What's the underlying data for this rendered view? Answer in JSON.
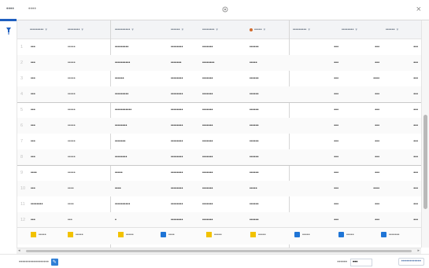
{
  "app": {
    "title": "••••",
    "sheet_name": "••••",
    "close_label": "×"
  },
  "columns": [
    {
      "label": "•••••••••"
    },
    {
      "label": "••••••••"
    },
    {
      "label": "••••••••••"
    },
    {
      "label": "••••••"
    },
    {
      "label": "••••••••"
    },
    {
      "label": "•••••"
    },
    {
      "label": "•••••••••"
    },
    {
      "label": "••••••••"
    },
    {
      "label": "••••••"
    }
  ],
  "rows": [
    {
      "num": "1",
      "name": "•••",
      "type": "•••••",
      "desc": "•••••••••",
      "d1": "••••••••",
      "d2": "•••••••",
      "code": "••••••",
      "v1": "•••",
      "v2": "•••",
      "v3": "•••"
    },
    {
      "num": "2",
      "name": "•••",
      "type": "•••••",
      "desc": "••••••••••",
      "d1": "•••••••",
      "d2": "••••••••",
      "code": "•••••",
      "v1": "•••",
      "v2": "•••",
      "v3": "•••"
    },
    {
      "num": "3",
      "name": "•••",
      "type": "•••••",
      "desc": "••••••",
      "d1": "••••••••",
      "d2": "•••••••",
      "code": "••••••",
      "v1": "•••",
      "v2": "••••",
      "v3": "•••"
    },
    {
      "num": "4",
      "name": "•••",
      "type": "•••••",
      "desc": "•••••••••",
      "d1": "••••••••",
      "d2": "•••••••",
      "code": "••••••",
      "v1": "•••",
      "v2": "•••",
      "v3": "•••"
    },
    {
      "num": "5",
      "name": "•••",
      "type": "•••••",
      "desc": "•••••••••••",
      "d1": "••••••••",
      "d2": "•••••••",
      "code": "••••••",
      "v1": "•••",
      "v2": "•••",
      "v3": "•••"
    },
    {
      "num": "6",
      "name": "•••",
      "type": "•••••",
      "desc": "••••••••",
      "d1": "••••••••",
      "d2": "•••••••",
      "code": "••••••",
      "v1": "•••",
      "v2": "•••",
      "v3": "•••"
    },
    {
      "num": "7",
      "name": "•••",
      "type": "•••••",
      "desc": "•••••••",
      "d1": "••••••••",
      "d2": "•••••••",
      "code": "••••••",
      "v1": "•••",
      "v2": "•••",
      "v3": "•••"
    },
    {
      "num": "8",
      "name": "•••",
      "type": "•••••",
      "desc": "••••••••",
      "d1": "••••••••",
      "d2": "•••••••",
      "code": "••••••",
      "v1": "•••",
      "v2": "•••",
      "v3": "•••"
    },
    {
      "num": "9",
      "name": "••••",
      "type": "•••••",
      "desc": "•••••",
      "d1": "••••••••",
      "d2": "•••••••",
      "code": "••••••",
      "v1": "•••",
      "v2": "•••",
      "v3": "•••"
    },
    {
      "num": "10",
      "name": "•••",
      "type": "••••",
      "desc": "••••",
      "d1": "••••••••",
      "d2": "•••••••",
      "code": "•••••",
      "v1": "•••",
      "v2": "••••",
      "v3": "•••"
    },
    {
      "num": "11",
      "name": "••••••••",
      "type": "••••",
      "desc": "••••••••••",
      "d1": "••••••••",
      "d2": "•••••••",
      "code": "••••••",
      "v1": "•••",
      "v2": "•••",
      "v3": "•••"
    },
    {
      "num": "12",
      "name": "•••",
      "type": "•••",
      "desc": "•",
      "d1": "••••••••",
      "d2": "•••••••",
      "code": "••••••",
      "v1": "•••",
      "v2": "•••",
      "v3": "•••"
    }
  ],
  "legend": [
    {
      "label": "•••••",
      "color": "#f2c200"
    },
    {
      "label": "•••••",
      "color": "#f2c200"
    },
    {
      "label": "•••••",
      "color": "#f2c200"
    },
    {
      "label": "••••",
      "color": "#1f75d6"
    },
    {
      "label": "•••••",
      "color": "#f2c200"
    },
    {
      "label": "•••••",
      "color": "#f2c200"
    },
    {
      "label": "•••••",
      "color": "#1f75d6"
    },
    {
      "label": "•••••",
      "color": "#1f75d6"
    },
    {
      "label": "•••••••",
      "color": "#1f75d6"
    }
  ],
  "footer": {
    "status": "••••••••••••••••••",
    "zoom_label": "••••••",
    "zoom_value": "•••",
    "mode_label": "••••••••••••"
  },
  "colors": {
    "accent": "#1f5fbf",
    "legend_yellow": "#f2c200",
    "legend_blue": "#1f75d6"
  }
}
